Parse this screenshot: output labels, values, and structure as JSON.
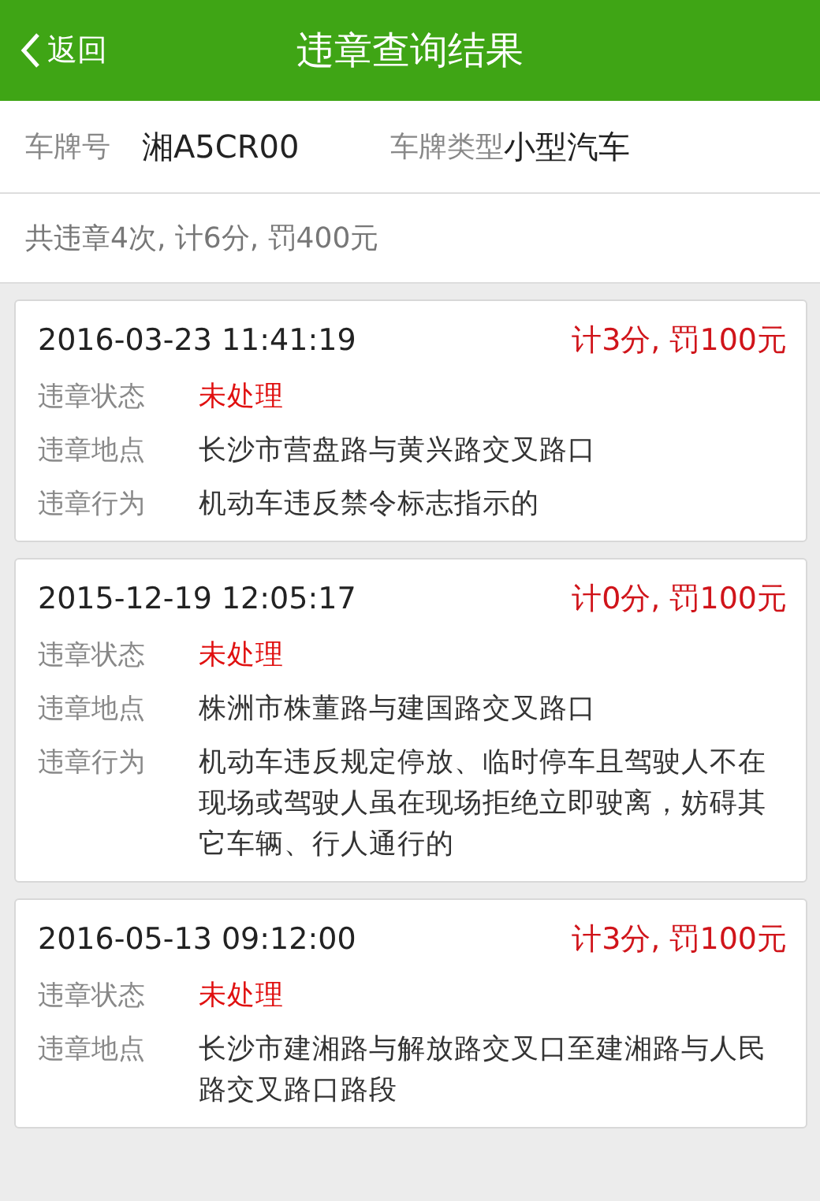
{
  "header": {
    "back": "返回",
    "title": "违章查询结果"
  },
  "vehicle": {
    "plate_label": "车牌号",
    "plate": "湘A5CR00",
    "type_label": "车牌类型",
    "type": "小型汽车"
  },
  "summary": "共违章4次, 计6分, 罚400元",
  "records": [
    {
      "time": "2016-03-23 11:41:19",
      "penalty": "计3分, 罚100元",
      "fields": [
        {
          "label": "违章状态",
          "value": "未处理",
          "kind": "status"
        },
        {
          "label": "违章地点",
          "value": "长沙市营盘路与黄兴路交叉路口",
          "kind": "text"
        },
        {
          "label": "违章行为",
          "value": "机动车违反禁令标志指示的",
          "kind": "text"
        }
      ]
    },
    {
      "time": "2015-12-19 12:05:17",
      "penalty": "计0分, 罚100元",
      "fields": [
        {
          "label": "违章状态",
          "value": "未处理",
          "kind": "status"
        },
        {
          "label": "违章地点",
          "value": "株洲市株董路与建国路交叉路口",
          "kind": "text"
        },
        {
          "label": "违章行为",
          "value": "机动车违反规定停放、临时停车且驾驶人不在现场或驾驶人虽在现场拒绝立即驶离，妨碍其它车辆、行人通行的",
          "kind": "text"
        }
      ]
    },
    {
      "time": "2016-05-13 09:12:00",
      "penalty": "计3分, 罚100元",
      "fields": [
        {
          "label": "违章状态",
          "value": "未处理",
          "kind": "status"
        },
        {
          "label": "违章地点",
          "value": "长沙市建湘路与解放路交叉口至建湘路与人民路交叉路口路段",
          "kind": "text"
        }
      ]
    }
  ]
}
